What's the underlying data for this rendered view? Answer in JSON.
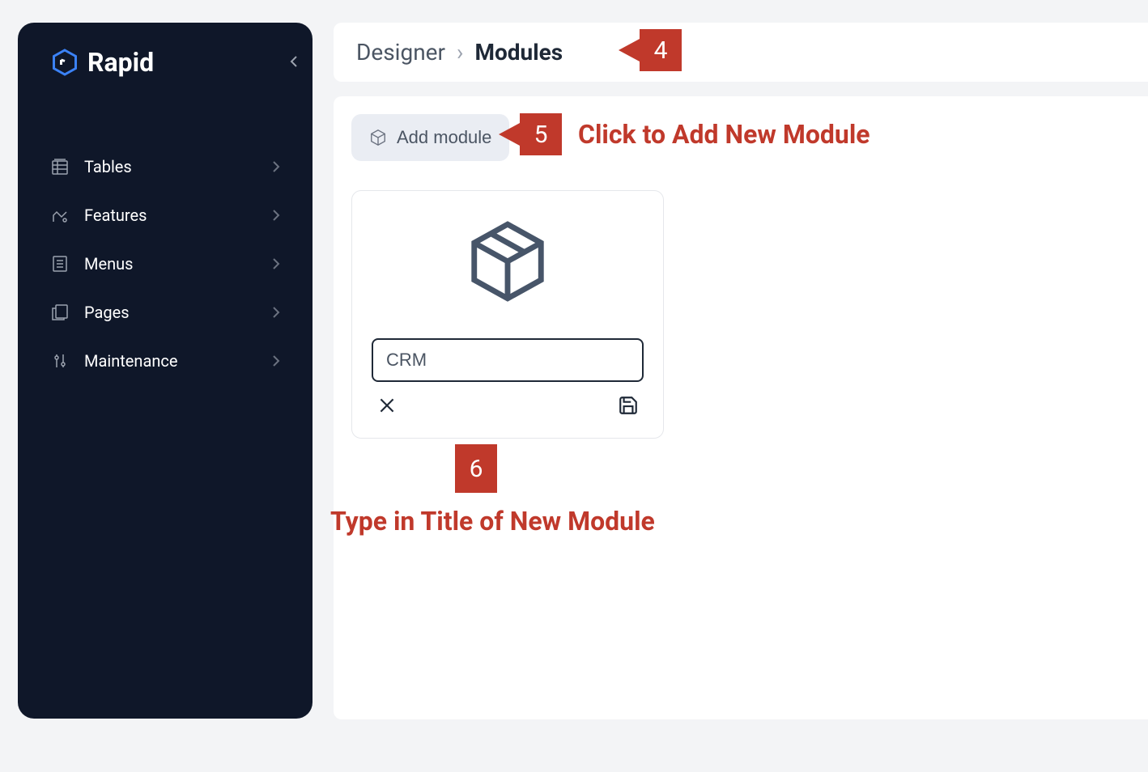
{
  "logo": {
    "text": "Rapid"
  },
  "sidebar": {
    "items": [
      {
        "label": "Tables",
        "icon": "tables"
      },
      {
        "label": "Features",
        "icon": "features"
      },
      {
        "label": "Menus",
        "icon": "menus"
      },
      {
        "label": "Pages",
        "icon": "pages"
      },
      {
        "label": "Maintenance",
        "icon": "maintenance"
      }
    ]
  },
  "breadcrumb": {
    "parent": "Designer",
    "current": "Modules"
  },
  "add_module": {
    "label": "Add module"
  },
  "module_card": {
    "title_value": "CRM"
  },
  "callouts": {
    "c4": {
      "number": "4"
    },
    "c5": {
      "number": "5",
      "text": "Click to Add New Module"
    },
    "c6": {
      "number": "6",
      "text": "Type in Title of New Module"
    }
  }
}
